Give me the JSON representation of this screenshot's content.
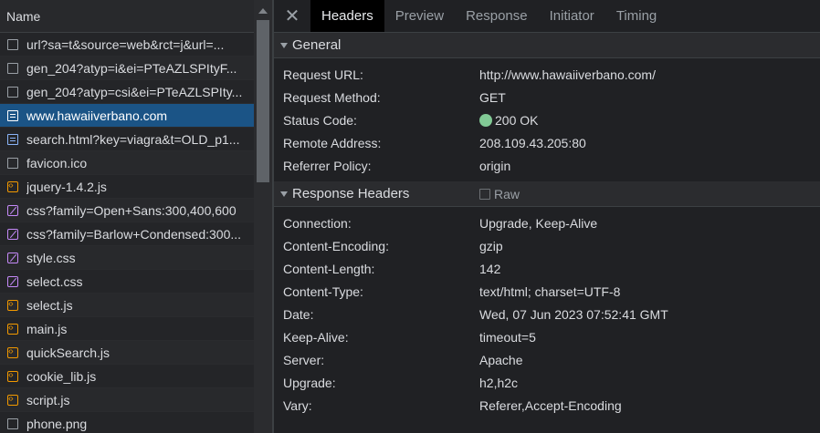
{
  "left": {
    "header": "Name",
    "requests": [
      {
        "label": "url?sa=t&source=web&rct=j&url=...",
        "icon": "doc-icon"
      },
      {
        "label": "gen_204?atyp=i&ei=PTeAZLSPItyF...",
        "icon": "doc-icon"
      },
      {
        "label": "gen_204?atyp=csi&ei=PTeAZLSPIty...",
        "icon": "doc-icon"
      },
      {
        "label": "www.hawaiiverbano.com",
        "icon": "html-icon"
      },
      {
        "label": "search.html?key=viagra&t=OLD_p1...",
        "icon": "html-icon"
      },
      {
        "label": "favicon.ico",
        "icon": "doc-icon"
      },
      {
        "label": "jquery-1.4.2.js",
        "icon": "js-icon"
      },
      {
        "label": "css?family=Open+Sans:300,400,600",
        "icon": "css-icon"
      },
      {
        "label": "css?family=Barlow+Condensed:300...",
        "icon": "css-icon"
      },
      {
        "label": "style.css",
        "icon": "css-icon"
      },
      {
        "label": "select.css",
        "icon": "css-icon"
      },
      {
        "label": "select.js",
        "icon": "js-icon"
      },
      {
        "label": "main.js",
        "icon": "js-icon"
      },
      {
        "label": "quickSearch.js",
        "icon": "js-icon"
      },
      {
        "label": "cookie_lib.js",
        "icon": "js-icon"
      },
      {
        "label": "script.js",
        "icon": "js-icon"
      },
      {
        "label": "phone.png",
        "icon": "img-icon"
      }
    ]
  },
  "tabs": [
    "Headers",
    "Preview",
    "Response",
    "Initiator",
    "Timing"
  ],
  "general": {
    "title": "General",
    "rows": [
      {
        "k": "Request URL:",
        "v": "http://www.hawaiiverbano.com/"
      },
      {
        "k": "Request Method:",
        "v": "GET"
      },
      {
        "k": "Status Code:",
        "v": "200 OK"
      },
      {
        "k": "Remote Address:",
        "v": "208.109.43.205:80"
      },
      {
        "k": "Referrer Policy:",
        "v": "origin"
      }
    ]
  },
  "response_headers": {
    "title": "Response Headers",
    "raw_label": "Raw",
    "rows": [
      {
        "k": "Connection:",
        "v": "Upgrade, Keep-Alive"
      },
      {
        "k": "Content-Encoding:",
        "v": "gzip"
      },
      {
        "k": "Content-Length:",
        "v": "142"
      },
      {
        "k": "Content-Type:",
        "v": "text/html; charset=UTF-8"
      },
      {
        "k": "Date:",
        "v": "Wed, 07 Jun 2023 07:52:41 GMT"
      },
      {
        "k": "Keep-Alive:",
        "v": "timeout=5"
      },
      {
        "k": "Server:",
        "v": "Apache"
      },
      {
        "k": "Upgrade:",
        "v": "h2,h2c"
      },
      {
        "k": "Vary:",
        "v": "Referer,Accept-Encoding"
      }
    ]
  },
  "colors": {
    "selected_row": "#1b5486",
    "status_ok": "#81c995",
    "background": "#202124"
  }
}
